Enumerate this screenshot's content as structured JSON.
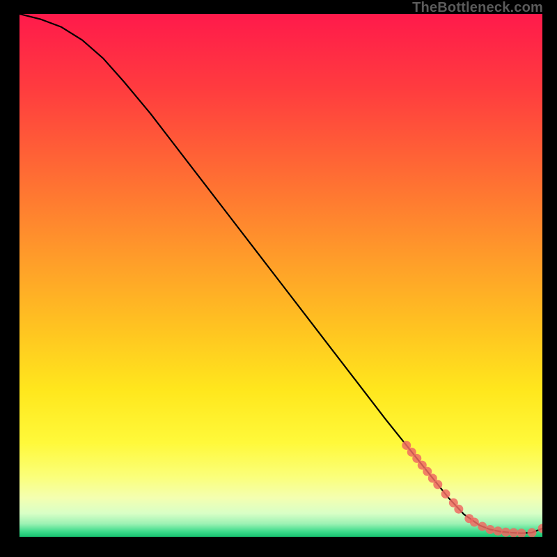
{
  "watermark": "TheBottleneck.com",
  "chart_data": {
    "type": "line",
    "title": "",
    "xlabel": "",
    "ylabel": "",
    "xlim": [
      0,
      100
    ],
    "ylim": [
      0,
      100
    ],
    "grid": false,
    "series": [
      {
        "name": "curve",
        "style": "line",
        "color": "#000000",
        "x": [
          0,
          4,
          8,
          12,
          16,
          20,
          25,
          30,
          35,
          40,
          45,
          50,
          55,
          60,
          65,
          70,
          74,
          78,
          82,
          85,
          88,
          90,
          92,
          94,
          96,
          98,
          100
        ],
        "y": [
          100,
          99,
          97.5,
          95,
          91.5,
          87,
          81,
          74.5,
          68,
          61.5,
          55,
          48.5,
          42,
          35.5,
          29,
          22.5,
          17.5,
          12.5,
          7.5,
          4.3,
          2.2,
          1.4,
          1.0,
          0.8,
          0.7,
          0.8,
          1.6
        ]
      },
      {
        "name": "highlight-points",
        "style": "scatter",
        "color": "#ef6a61",
        "x": [
          74,
          75,
          76,
          77,
          78,
          79,
          80,
          81.5,
          83,
          84,
          86,
          87,
          88.5,
          90,
          91.5,
          93,
          94.5,
          96,
          98,
          100
        ],
        "y": [
          17.5,
          16.2,
          15.0,
          13.7,
          12.5,
          11.2,
          10.0,
          8.2,
          6.5,
          5.3,
          3.5,
          2.8,
          2.0,
          1.4,
          1.1,
          0.9,
          0.8,
          0.7,
          0.8,
          1.6
        ]
      }
    ],
    "background_gradient": {
      "stops": [
        {
          "offset": 0.0,
          "color": "#ff1a4b"
        },
        {
          "offset": 0.14,
          "color": "#ff3b3f"
        },
        {
          "offset": 0.3,
          "color": "#ff6a34"
        },
        {
          "offset": 0.46,
          "color": "#ff9a2a"
        },
        {
          "offset": 0.6,
          "color": "#ffc321"
        },
        {
          "offset": 0.72,
          "color": "#ffe71d"
        },
        {
          "offset": 0.82,
          "color": "#fff93a"
        },
        {
          "offset": 0.885,
          "color": "#fbff7a"
        },
        {
          "offset": 0.925,
          "color": "#f4ffb0"
        },
        {
          "offset": 0.955,
          "color": "#d9ffc6"
        },
        {
          "offset": 0.975,
          "color": "#9df2b4"
        },
        {
          "offset": 0.99,
          "color": "#3ddb8b"
        },
        {
          "offset": 1.0,
          "color": "#18c270"
        }
      ]
    }
  }
}
